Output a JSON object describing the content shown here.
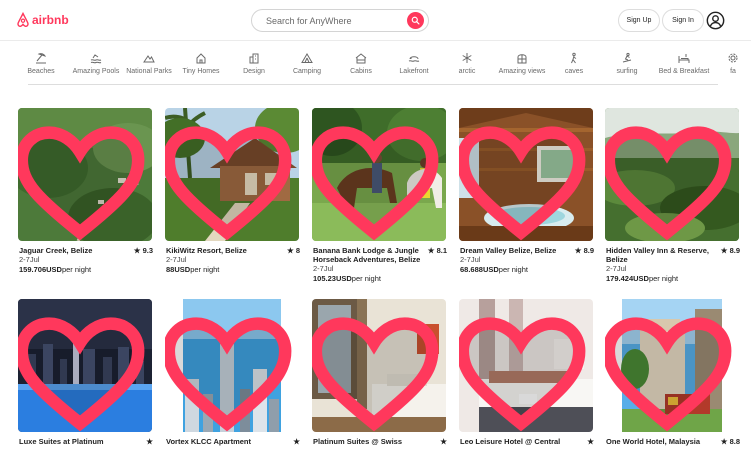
{
  "header": {
    "logo": "airbnb",
    "search_placeholder": "Search for AnyWhere",
    "signup_label": "Sign Up",
    "signin_label": "Sign In"
  },
  "categories": [
    {
      "label": "Beaches",
      "icon": "beach-icon"
    },
    {
      "label": "Amazing Pools",
      "icon": "pool-icon"
    },
    {
      "label": "National Parks",
      "icon": "mountain-icon"
    },
    {
      "label": "Tiny Homes",
      "icon": "house-icon"
    },
    {
      "label": "Design",
      "icon": "design-icon"
    },
    {
      "label": "Camping",
      "icon": "tent-icon"
    },
    {
      "label": "Cabins",
      "icon": "cabin-icon"
    },
    {
      "label": "Lakefront",
      "icon": "lake-icon"
    },
    {
      "label": "arctic",
      "icon": "snowflake-icon"
    },
    {
      "label": "Amazing views",
      "icon": "views-icon"
    },
    {
      "label": "caves",
      "icon": "hiker-icon"
    },
    {
      "label": "surfing",
      "icon": "surfer-icon"
    },
    {
      "label": "Bed & Breakfast",
      "icon": "bed-icon"
    },
    {
      "label": "fa",
      "icon": "gear-icon"
    }
  ],
  "listings": [
    {
      "title": "Jaguar Creek, Belize",
      "rating": "★ 9.3",
      "dates": "2-7Jul",
      "price": "159.706USD",
      "price_suffix": "per night",
      "image": "forest-aerial"
    },
    {
      "title": "KikiWitz Resort, Belize",
      "rating": "★ 8",
      "dates": "2-7Jul",
      "price": "88USD",
      "price_suffix": "per night",
      "image": "cabin-palms"
    },
    {
      "title": "Banana Bank Lodge & Jungle Horseback Adventures, Belize",
      "rating": "★ 8.1",
      "dates": "2-7Jul",
      "price": "105.23USD",
      "price_suffix": "per night",
      "image": "horses"
    },
    {
      "title": "Dream Valley Belize, Belize",
      "rating": "★ 8.9",
      "dates": "2-7Jul",
      "price": "68.688USD",
      "price_suffix": "per night",
      "image": "wood-interior"
    },
    {
      "title": "Hidden Valley Inn & Reserve, Belize",
      "rating": "★ 8.9",
      "dates": "2-7Jul",
      "price": "179.424USD",
      "price_suffix": "per night",
      "image": "forest-hills"
    },
    {
      "title": "Luxe Suites at Platinum",
      "rating": "★",
      "image": "night-city"
    },
    {
      "title": "Vortex KLCC Apartment",
      "rating": "★",
      "image": "towers"
    },
    {
      "title": "Platinum Suites @ Swiss",
      "rating": "★",
      "image": "hotel-room"
    },
    {
      "title": "Leo Leisure Hotel @ Central",
      "rating": "★",
      "image": "hotel-bedroom"
    },
    {
      "title": "One World Hotel, Malaysia",
      "rating": "★ 8.8",
      "image": "hotel-building"
    }
  ],
  "colors": {
    "brand": "#ff385c",
    "text": "#222222",
    "muted": "#6a6a6a",
    "border": "#dddddd"
  }
}
